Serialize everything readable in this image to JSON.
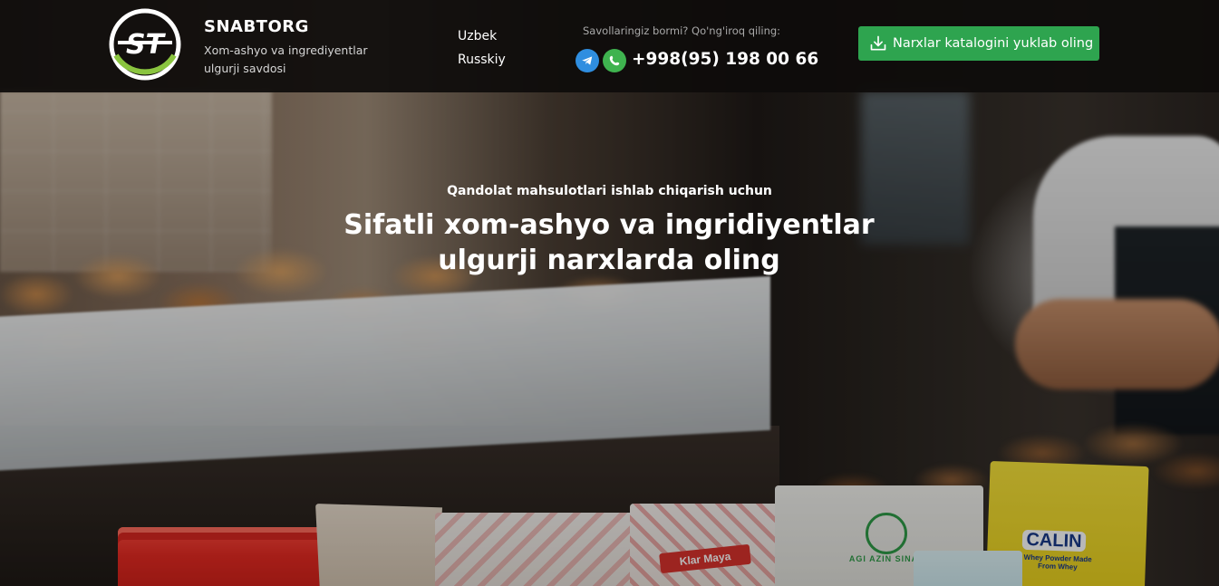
{
  "header": {
    "brand": {
      "logo_text": "ST",
      "name": "SNABTORG",
      "tagline": "Xom-ashyo va ingrediyentlar ulgurji savdosi"
    },
    "languages": [
      {
        "label": "Uzbek"
      },
      {
        "label": "Russkiy"
      }
    ],
    "contact": {
      "caption": "Savollaringiz bormi? Qo'ng'iroq qiling:",
      "messengers": [
        {
          "icon": "telegram-icon",
          "color": "#2f8ee0"
        },
        {
          "icon": "whatsapp-icon",
          "color": "#3fb34f"
        }
      ],
      "phone": "+998(95) 198 00 66"
    },
    "download_button": {
      "icon": "download-icon",
      "label": "Narxlar katalogini yuklab oling",
      "color": "#2ea44f"
    }
  },
  "hero": {
    "subtitle": "Qandolat mahsulotlari ishlab chiqarish uchun",
    "title": "Sifatli xom-ashyo va ingridiyentlar ulgurji narxlarda oling"
  },
  "products": {
    "klar_label": "Klar Maya",
    "green_bag_label": "AGI AZIN SINA",
    "calin_label": "CALIN",
    "calin_sub": "Whey Powder Made From Whey"
  },
  "colors": {
    "logo_accent": "#8ac43f",
    "header_bg": "#0e0c0b"
  }
}
